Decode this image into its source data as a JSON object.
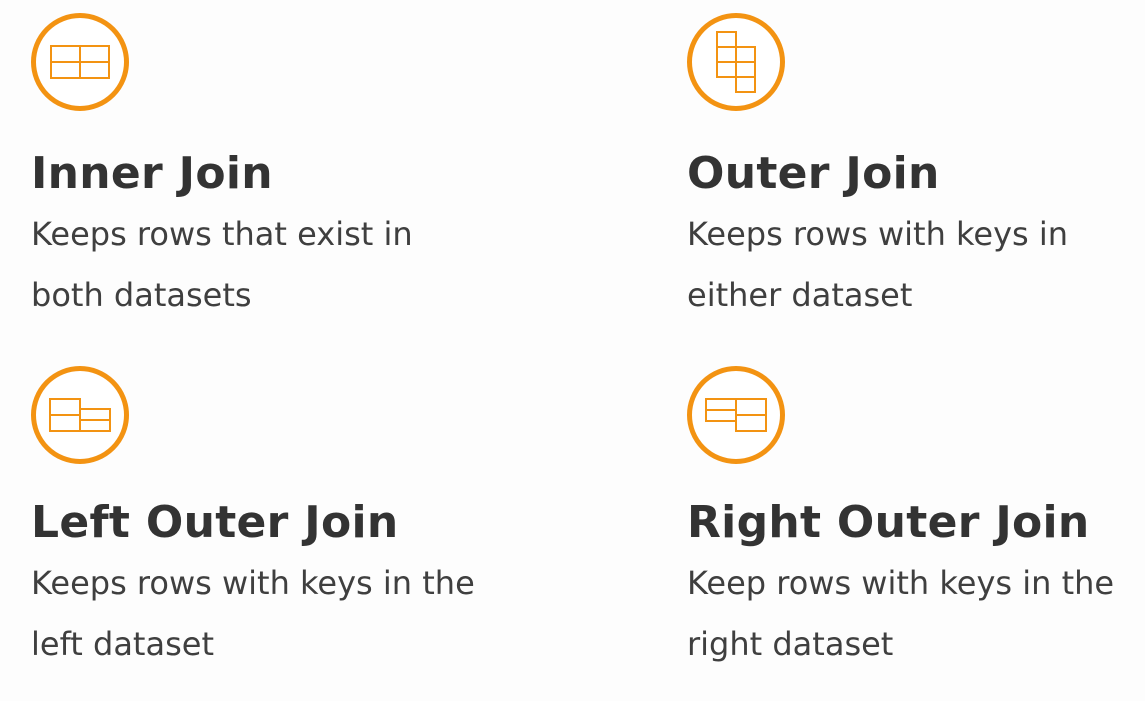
{
  "accent_color": "#f39312",
  "cards": [
    {
      "icon": "inner-join-table-icon",
      "title": "Inner Join",
      "desc_line1": "Keeps rows that exist in",
      "desc_line2": "both datasets"
    },
    {
      "icon": "outer-join-table-icon",
      "title": "Outer Join",
      "desc_line1": "Keeps rows with keys in",
      "desc_line2": "either dataset"
    },
    {
      "icon": "left-outer-join-table-icon",
      "title": "Left Outer Join",
      "desc_line1": "Keeps rows with keys in the",
      "desc_line2": "left dataset"
    },
    {
      "icon": "right-outer-join-table-icon",
      "title": "Right Outer Join",
      "desc_line1": "Keep rows with keys in the",
      "desc_line2": "right dataset"
    }
  ]
}
